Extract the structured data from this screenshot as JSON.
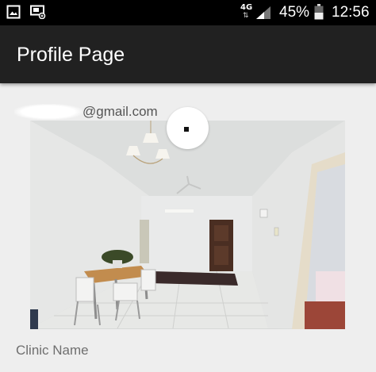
{
  "status_bar": {
    "network_type": "4G",
    "network_arrows": "⇅",
    "battery_percent": "45%",
    "time": "12:56",
    "icons": [
      "image-icon",
      "cast-icon",
      "network-4g-icon",
      "signal-icon",
      "battery-icon"
    ]
  },
  "app_bar": {
    "title": "Profile Page",
    "background": "#212121"
  },
  "profile": {
    "email_suffix": "@gmail.com",
    "avatar_icon": "profile-picture-icon",
    "photo_icon": "room-photo-image"
  },
  "form": {
    "clinic_name_label": "Clinic Name"
  }
}
